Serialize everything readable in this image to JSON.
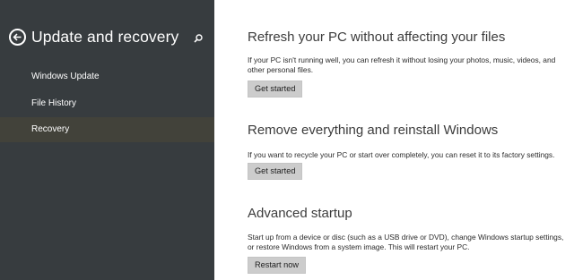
{
  "sidebar": {
    "title": "Update and recovery",
    "back_icon": "back-arrow-icon",
    "search_icon": "search-icon",
    "items": [
      {
        "label": "Windows Update",
        "selected": false
      },
      {
        "label": "File History",
        "selected": false
      },
      {
        "label": "Recovery",
        "selected": true
      }
    ],
    "background_color": "#373c3f",
    "selected_color": "#42423a"
  },
  "main": {
    "sections": [
      {
        "title": "Refresh your PC without affecting your files",
        "description": "If your PC isn't running well, you can refresh it without losing your photos, music, videos, and other personal files.",
        "button_label": "Get started"
      },
      {
        "title": "Remove everything and reinstall Windows",
        "description": "If you want to recycle your PC or start over completely, you can reset it to its factory settings.",
        "button_label": "Get started"
      },
      {
        "title": "Advanced startup",
        "description": "Start up from a device or disc (such as a USB drive or DVD), change Windows startup settings, or restore Windows from a system image. This will restart your PC.",
        "button_label": "Restart now"
      }
    ]
  }
}
